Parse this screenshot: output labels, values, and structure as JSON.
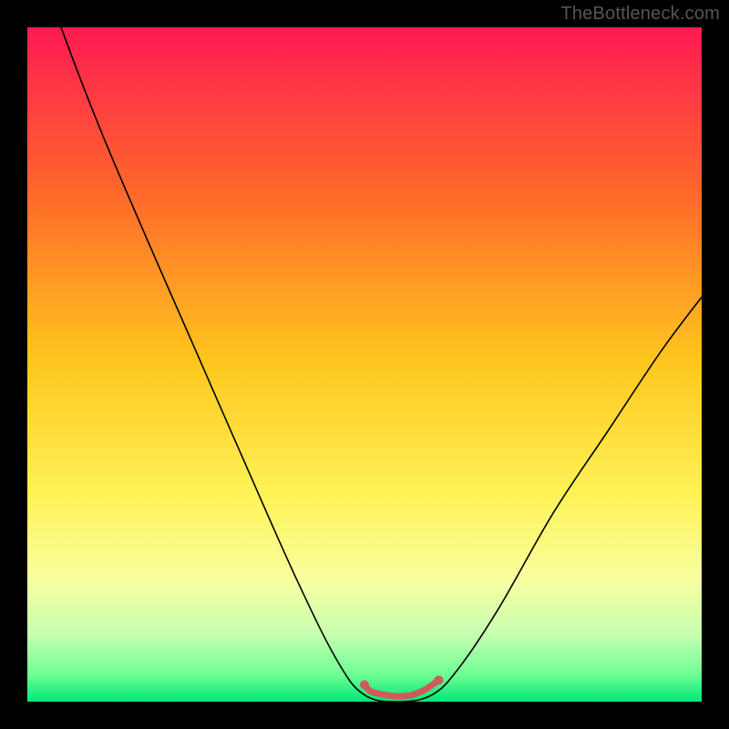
{
  "watermark": "TheBottleneck.com",
  "chart_data": {
    "type": "line",
    "title": "",
    "xlabel": "",
    "ylabel": "",
    "x_range": [
      0,
      100
    ],
    "y_range": [
      0,
      100
    ],
    "grid": false,
    "legend": false,
    "gradient": {
      "stops": [
        {
          "offset": 0.0,
          "color": "#ff1a52"
        },
        {
          "offset": 0.25,
          "color": "#ff6a2a"
        },
        {
          "offset": 0.5,
          "color": "#ffc81e"
        },
        {
          "offset": 0.7,
          "color": "#fff45a"
        },
        {
          "offset": 0.82,
          "color": "#f7ffa0"
        },
        {
          "offset": 0.9,
          "color": "#c8ffb0"
        },
        {
          "offset": 0.96,
          "color": "#6eff94"
        },
        {
          "offset": 1.0,
          "color": "#00e676"
        }
      ]
    },
    "series": [
      {
        "name": "bottleneck-curve",
        "stroke": "#000000",
        "fill": null,
        "points": [
          {
            "x": 5,
            "y": 100
          },
          {
            "x": 8,
            "y": 92
          },
          {
            "x": 12,
            "y": 82
          },
          {
            "x": 18,
            "y": 68
          },
          {
            "x": 25,
            "y": 52
          },
          {
            "x": 32,
            "y": 36
          },
          {
            "x": 40,
            "y": 18
          },
          {
            "x": 46,
            "y": 6
          },
          {
            "x": 50,
            "y": 1
          },
          {
            "x": 55,
            "y": 0
          },
          {
            "x": 60,
            "y": 1
          },
          {
            "x": 64,
            "y": 5
          },
          {
            "x": 70,
            "y": 14
          },
          {
            "x": 78,
            "y": 28
          },
          {
            "x": 86,
            "y": 40
          },
          {
            "x": 94,
            "y": 52
          },
          {
            "x": 100,
            "y": 60
          }
        ]
      },
      {
        "name": "valley-marker",
        "stroke": "#d05a5a",
        "fill": null,
        "points": [
          {
            "x": 50,
            "y": 2.5
          },
          {
            "x": 51,
            "y": 1.5
          },
          {
            "x": 53,
            "y": 1.0
          },
          {
            "x": 55,
            "y": 0.8
          },
          {
            "x": 57,
            "y": 1.0
          },
          {
            "x": 59,
            "y": 1.8
          },
          {
            "x": 61,
            "y": 3.2
          }
        ]
      }
    ],
    "annotations": []
  }
}
